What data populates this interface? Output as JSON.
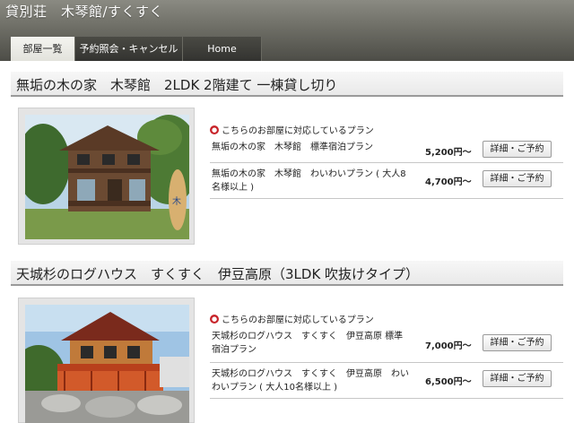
{
  "header": {
    "site_title": "貸別荘　木琴館/すくすく",
    "tabs": [
      {
        "label": "部屋一覧",
        "active": true
      },
      {
        "label": "予約照会・キャンセル",
        "active": false
      },
      {
        "label": "Home",
        "active": false
      }
    ]
  },
  "rooms": [
    {
      "title": "無垢の木の家　木琴館　2LDK 2階建て 一棟貸し切り",
      "photo": "wooden-two-story-cottage",
      "plans_caption": "こちらのお部屋に対応しているプラン",
      "plans": [
        {
          "name": "無垢の木の家　木琴館　標準宿泊プラン",
          "price": "5,200円～",
          "button": "詳細・ご予約"
        },
        {
          "name": "無垢の木の家　木琴館　わいわいプラン ( 大人8名様以上 )",
          "price": "4,700円～",
          "button": "詳細・ご予約"
        }
      ]
    },
    {
      "title": "天城杉のログハウス　すくすく　伊豆高原（3LDK 吹抜けタイプ）",
      "photo": "log-house-with-red-deck",
      "plans_caption": "こちらのお部屋に対応しているプラン",
      "plans": [
        {
          "name": "天城杉のログハウス　すくすく　伊豆高原 標準宿泊プラン",
          "price": "7,000円～",
          "button": "詳細・ご予約"
        },
        {
          "name": "天城杉のログハウス　すくすく　伊豆高原　わいわいプラン ( 大人10名様以上 )",
          "price": "6,500円～",
          "button": "詳細・ご予約"
        }
      ]
    }
  ],
  "icons": {
    "plan_bullet": "red-circle-icon"
  },
  "colors": {
    "header": "#6e6e66",
    "bullet": "#c8242a",
    "active_tab": "#e8e8e4"
  }
}
